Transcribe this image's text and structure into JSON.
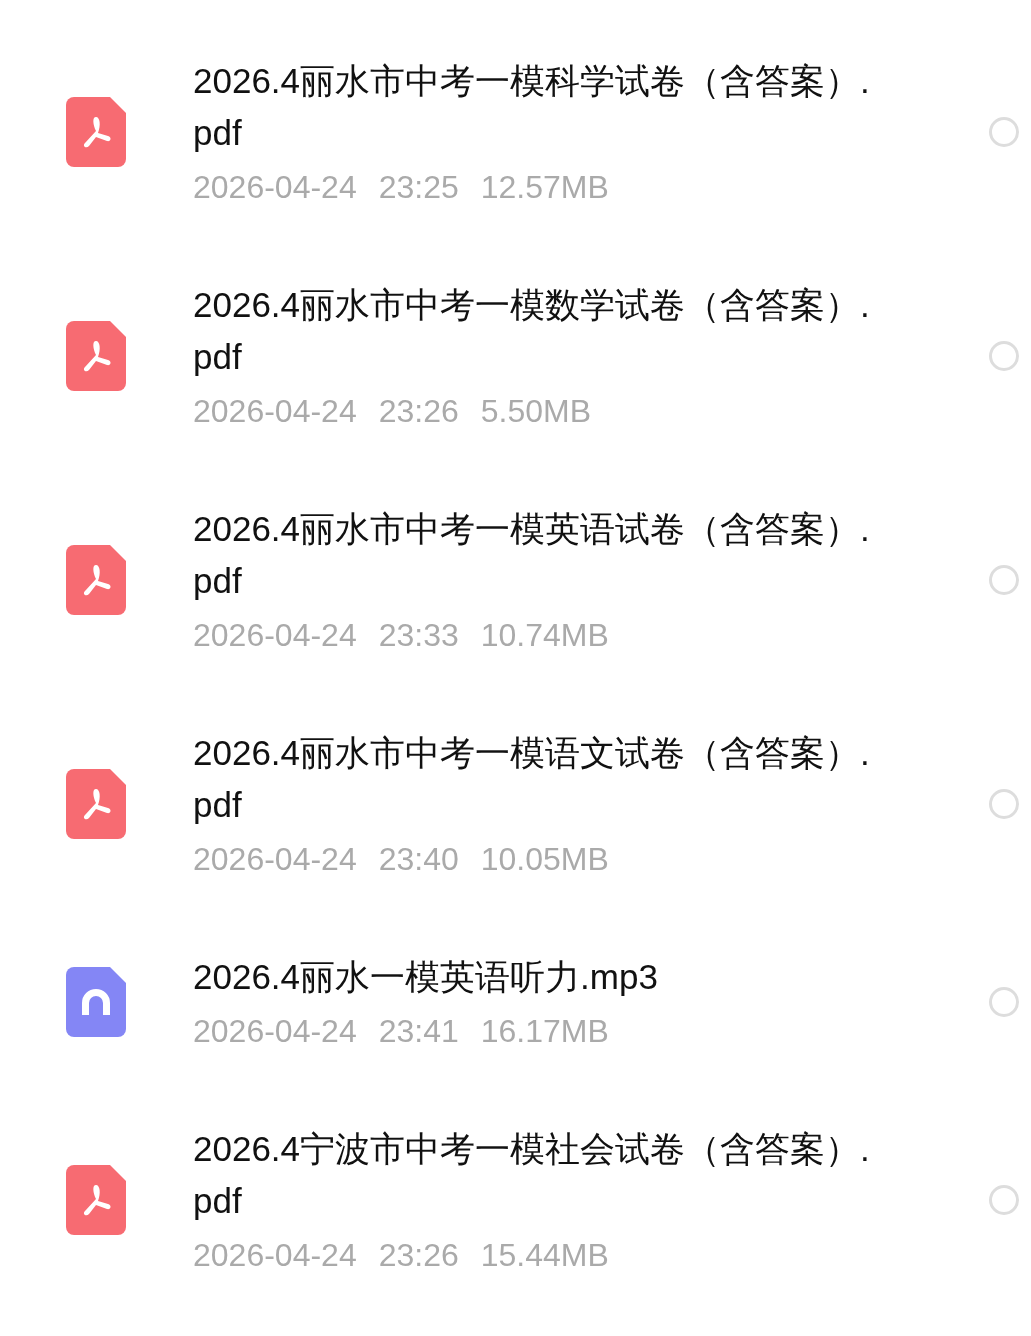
{
  "files": [
    {
      "kind": "pdf",
      "name": "2026.4丽水市中考一模科学试卷（含答案）.pdf",
      "date": "2026-04-24",
      "time": "23:25",
      "size": "12.57MB",
      "selected": false
    },
    {
      "kind": "pdf",
      "name": "2026.4丽水市中考一模数学试卷（含答案）.pdf",
      "date": "2026-04-24",
      "time": "23:26",
      "size": "5.50MB",
      "selected": false
    },
    {
      "kind": "pdf",
      "name": "2026.4丽水市中考一模英语试卷（含答案）.pdf",
      "date": "2026-04-24",
      "time": "23:33",
      "size": "10.74MB",
      "selected": false
    },
    {
      "kind": "pdf",
      "name": "2026.4丽水市中考一模语文试卷（含答案）.pdf",
      "date": "2026-04-24",
      "time": "23:40",
      "size": "10.05MB",
      "selected": false
    },
    {
      "kind": "audio",
      "name": "2026.4丽水一模英语听力.mp3",
      "date": "2026-04-24",
      "time": "23:41",
      "size": "16.17MB",
      "selected": false
    },
    {
      "kind": "pdf",
      "name": "2026.4宁波市中考一模社会试卷（含答案）.pdf",
      "date": "2026-04-24",
      "time": "23:26",
      "size": "15.44MB",
      "selected": false
    }
  ]
}
